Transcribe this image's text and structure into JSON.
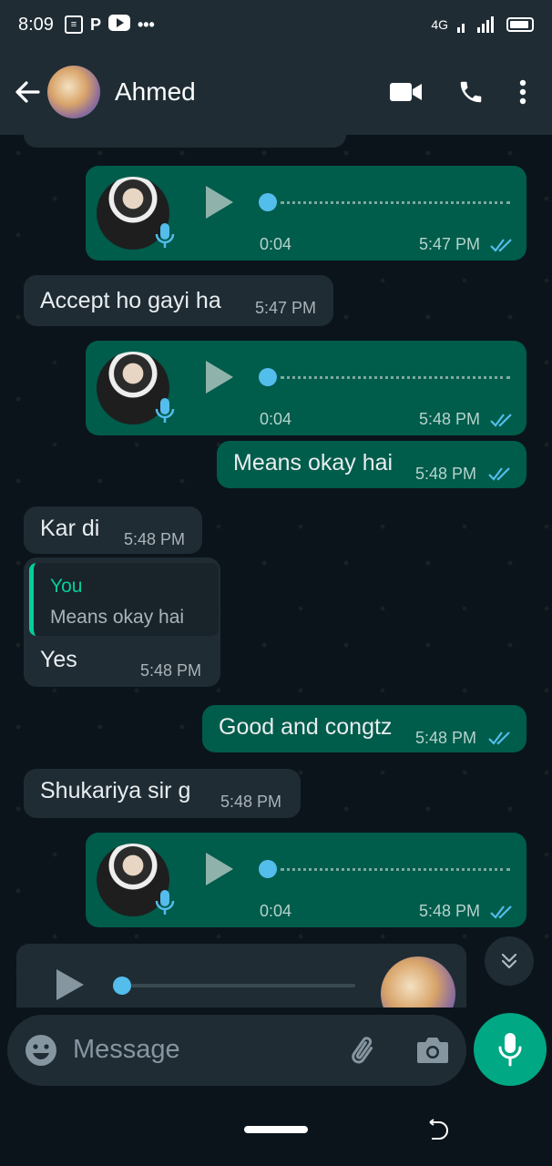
{
  "status_bar": {
    "time": "8:09",
    "network": "4G"
  },
  "header": {
    "contact_name": "Ahmed"
  },
  "messages": [
    {
      "type": "voice",
      "direction": "out",
      "duration": "0:04",
      "time": "5:47 PM",
      "status": "read"
    },
    {
      "type": "text",
      "direction": "in",
      "text": "Accept ho gayi ha",
      "time": "5:47 PM"
    },
    {
      "type": "voice",
      "direction": "out",
      "duration": "0:04",
      "time": "5:48 PM",
      "status": "read"
    },
    {
      "type": "text",
      "direction": "out",
      "text": "Means okay hai",
      "time": "5:48 PM",
      "status": "read"
    },
    {
      "type": "text",
      "direction": "in",
      "text": "Kar di",
      "time": "5:48 PM"
    },
    {
      "type": "reply",
      "direction": "in",
      "quote_name": "You",
      "quote_text": "Means okay hai",
      "text": "Yes",
      "time": "5:48 PM"
    },
    {
      "type": "text",
      "direction": "out",
      "text": "Good and congtz",
      "time": "5:48 PM",
      "status": "read"
    },
    {
      "type": "text",
      "direction": "in",
      "text": "Shukariya sir g",
      "time": "5:48 PM"
    },
    {
      "type": "voice",
      "direction": "out",
      "duration": "0:04",
      "time": "5:48 PM",
      "status": "read"
    }
  ],
  "composer": {
    "placeholder": "Message"
  },
  "colors": {
    "background": "#0b141a",
    "bar": "#1f2c34",
    "outgoing_bubble": "#005c4b",
    "incoming_bubble": "#1f2c34",
    "accent": "#00a884",
    "read_ticks": "#53bdeb"
  },
  "icons": [
    "back-arrow-icon",
    "video-call-icon",
    "phone-icon",
    "more-options-icon",
    "play-icon",
    "mic-icon",
    "double-check-icon",
    "chevron-double-down-icon",
    "emoji-icon",
    "attach-icon",
    "camera-icon"
  ]
}
